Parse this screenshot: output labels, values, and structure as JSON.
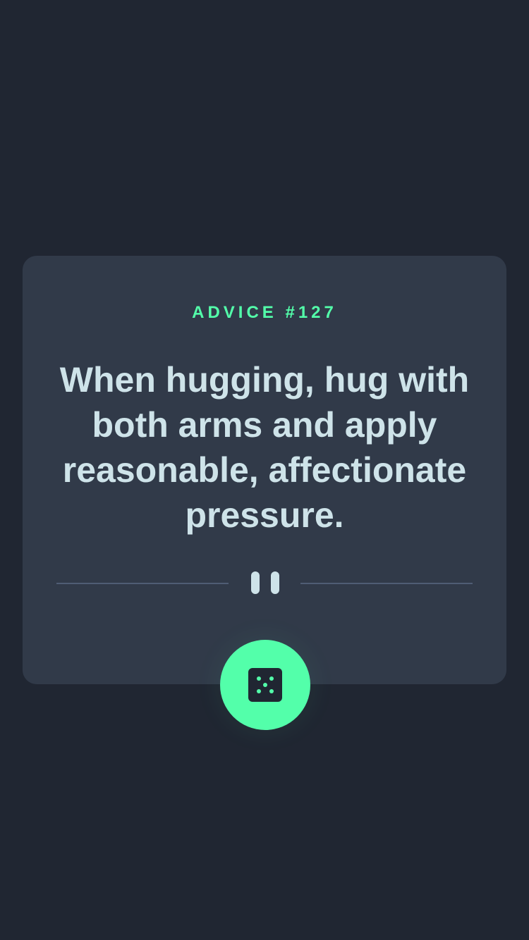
{
  "advice": {
    "label": "ADVICE #127",
    "text": "When hugging, hug with both arms and apply reasonable, affectionate pressure."
  },
  "divider": {
    "icon": "pause-icon"
  },
  "button": {
    "icon": "dice-icon",
    "accessible_label": "Get new advice"
  },
  "colors": {
    "background": "#202632",
    "card": "#313a49",
    "accent": "#53ffaa",
    "text": "#cee3e9",
    "divider": "#4f5d74"
  }
}
